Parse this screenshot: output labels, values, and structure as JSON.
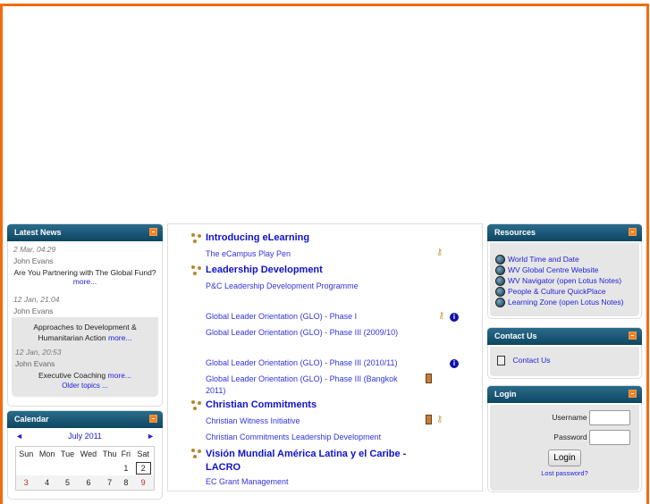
{
  "latest_news": {
    "title": "Latest News",
    "items": [
      {
        "date": "2 Mar, 04:29",
        "author": "John Evans",
        "title": "Are You Partnering with The Global Fund?",
        "more": "more..."
      },
      {
        "date": "12 Jan, 21:04",
        "author": "John Evans",
        "title": "Approaches to Development & Humanitarian Action",
        "more": "more..."
      },
      {
        "date": "12 Jan, 20:53",
        "author": "John Evans",
        "title": "Executive Coaching",
        "more": "more..."
      }
    ],
    "older": "Older topics ..."
  },
  "calendar": {
    "title": "Calendar",
    "month": "July 2011",
    "prev": "◄",
    "next": "►",
    "days": [
      "Sun",
      "Mon",
      "Tue",
      "Wed",
      "Thu",
      "Fri",
      "Sat"
    ],
    "weeks": [
      [
        "",
        "",
        "",
        "",
        "",
        "1",
        "2"
      ],
      [
        "3",
        "4",
        "5",
        "6",
        "7",
        "8",
        "9"
      ]
    ],
    "today": "2"
  },
  "main": {
    "sections": [
      {
        "title": "Introducing eLearning",
        "courses": [
          "The eCampus Play Pen"
        ]
      },
      {
        "title": "Leadership Development",
        "courses": [
          "P&C Leadership Development Programme",
          "Global Leader Orientation (GLO) - Phase I",
          "Global Leader Orientation (GLO) - Phase III (2009/10)",
          "Global Leader Orientation (GLO) - Phase III (2010/11)",
          "Global Leader Orientation (GLO) - Phase III (Bangkok 2011)"
        ]
      },
      {
        "title": "Christian Commitments",
        "courses": [
          "Christian Witness Initiative",
          "Christian Commitments Leadership Development"
        ]
      },
      {
        "title": "Visión Mundial América Latina y el Caribe - LACRO",
        "courses": [
          "EC Grant Management"
        ]
      }
    ]
  },
  "resources": {
    "title": "Resources",
    "links": [
      "World Time and Date",
      "WV Global Centre Website",
      "WV Navigator (open Lotus Notes)",
      "People & Culture QuickPlace",
      "Learning Zone (open Lotus Notes)"
    ]
  },
  "contact": {
    "title": "Contact Us",
    "link": "Contact Us"
  },
  "login": {
    "title": "Login",
    "username_label": "Username",
    "password_label": "Password",
    "button": "Login",
    "lost": "Lost password?"
  },
  "colors": {
    "accent": "#f26b10",
    "header": "#0d4661",
    "link": "#2222dd"
  }
}
